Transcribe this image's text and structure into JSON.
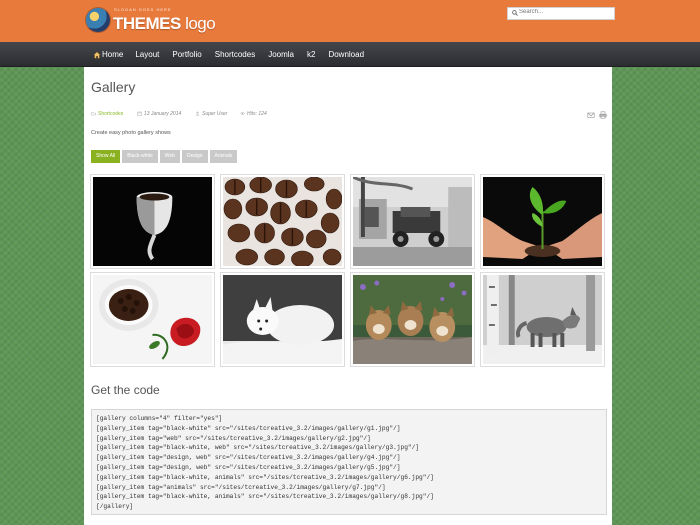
{
  "header": {
    "logo_text_bold": "THEMES",
    "logo_text_light": " logo",
    "logo_tagline": "SLOGAN GOES HERE",
    "search_placeholder": "Search..."
  },
  "nav": {
    "items": [
      {
        "label": "Home"
      },
      {
        "label": "Layout"
      },
      {
        "label": "Portfolio"
      },
      {
        "label": "Shortcodes"
      },
      {
        "label": "Joomla"
      },
      {
        "label": "k2"
      },
      {
        "label": "Download"
      }
    ]
  },
  "page": {
    "title": "Gallery",
    "meta": {
      "category": "Shortcodes",
      "date": "13 January 2014",
      "author": "Super User",
      "hits": "Hits: 124"
    },
    "intro": "Create easy photo gallery shows",
    "filters": [
      {
        "label": "Show All",
        "active": true
      },
      {
        "label": "Black-white",
        "active": false
      },
      {
        "label": "Web",
        "active": false
      },
      {
        "label": "Design",
        "active": false
      },
      {
        "label": "Animals",
        "active": false
      }
    ],
    "gallery": [
      {
        "subject": "coffee-cup-icon"
      },
      {
        "subject": "coffee-beans-icon"
      },
      {
        "subject": "vintage-car-icon"
      },
      {
        "subject": "plant-sprout-icon"
      },
      {
        "subject": "coffee-rose-icon"
      },
      {
        "subject": "arctic-fox-icon"
      },
      {
        "subject": "fox-cubs-icon"
      },
      {
        "subject": "wolf-icon"
      }
    ],
    "code_title": "Get the code",
    "code_lines": [
      "[gallery columns=\"4\" filter=\"yes\"]",
      "[gallery_item tag=\"black-white\" src=\"/sites/tcreative_3.2/images/gallery/g1.jpg\"/]",
      "[gallery_item tag=\"web\" src=\"/sites/tcreative_3.2/images/gallery/g2.jpg\"/]",
      "[gallery_item tag=\"black-white, web\" src=\"/sites/tcreative_3.2/images/gallery/g3.jpg\"/]",
      "[gallery_item tag=\"design, web\" src=\"/sites/tcreative_3.2/images/gallery/g4.jpg\"/]",
      "[gallery_item tag=\"design, web\" src=\"/sites/tcreative_3.2/images/gallery/g5.jpg\"/]",
      "[gallery_item tag=\"black-white, animals\" src=\"/sites/tcreative_3.2/images/gallery/g6.jpg\"/]",
      "[gallery_item tag=\"animals\" src=\"/sites/tcreative_3.2/images/gallery/g7.jpg\"/]",
      "[gallery_item tag=\"black-white, animals\" src=\"/sites/tcreative_3.2/images/gallery/g8.jpg\"/]",
      "[/gallery]"
    ]
  },
  "colors": {
    "header_orange": "#e87a3c",
    "nav_dark": "#37383d",
    "background_green": "#5e9656",
    "accent_green": "#8ab11f"
  }
}
